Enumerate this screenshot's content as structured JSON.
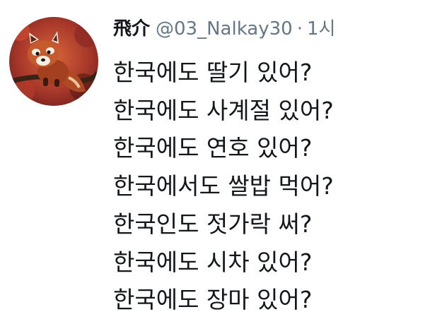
{
  "tweet": {
    "author": {
      "display_name": "飛介",
      "handle": "@03_Nalkay30",
      "avatar_icon": "red-panda-avatar-icon"
    },
    "separator": "·",
    "timestamp": "1시",
    "lines": [
      "한국에도 딸기 있어?",
      "한국에도 사계절 있어?",
      "한국에도 연호 있어?",
      "한국에서도 쌀밥 먹어?",
      "한국인도 젓가락 써?",
      "한국에도 시차 있어?",
      "한국에도 장마 있어?"
    ]
  },
  "colors": {
    "name": "#14171a",
    "secondary": "#657786",
    "text": "#14171a",
    "background": "#ffffff"
  }
}
